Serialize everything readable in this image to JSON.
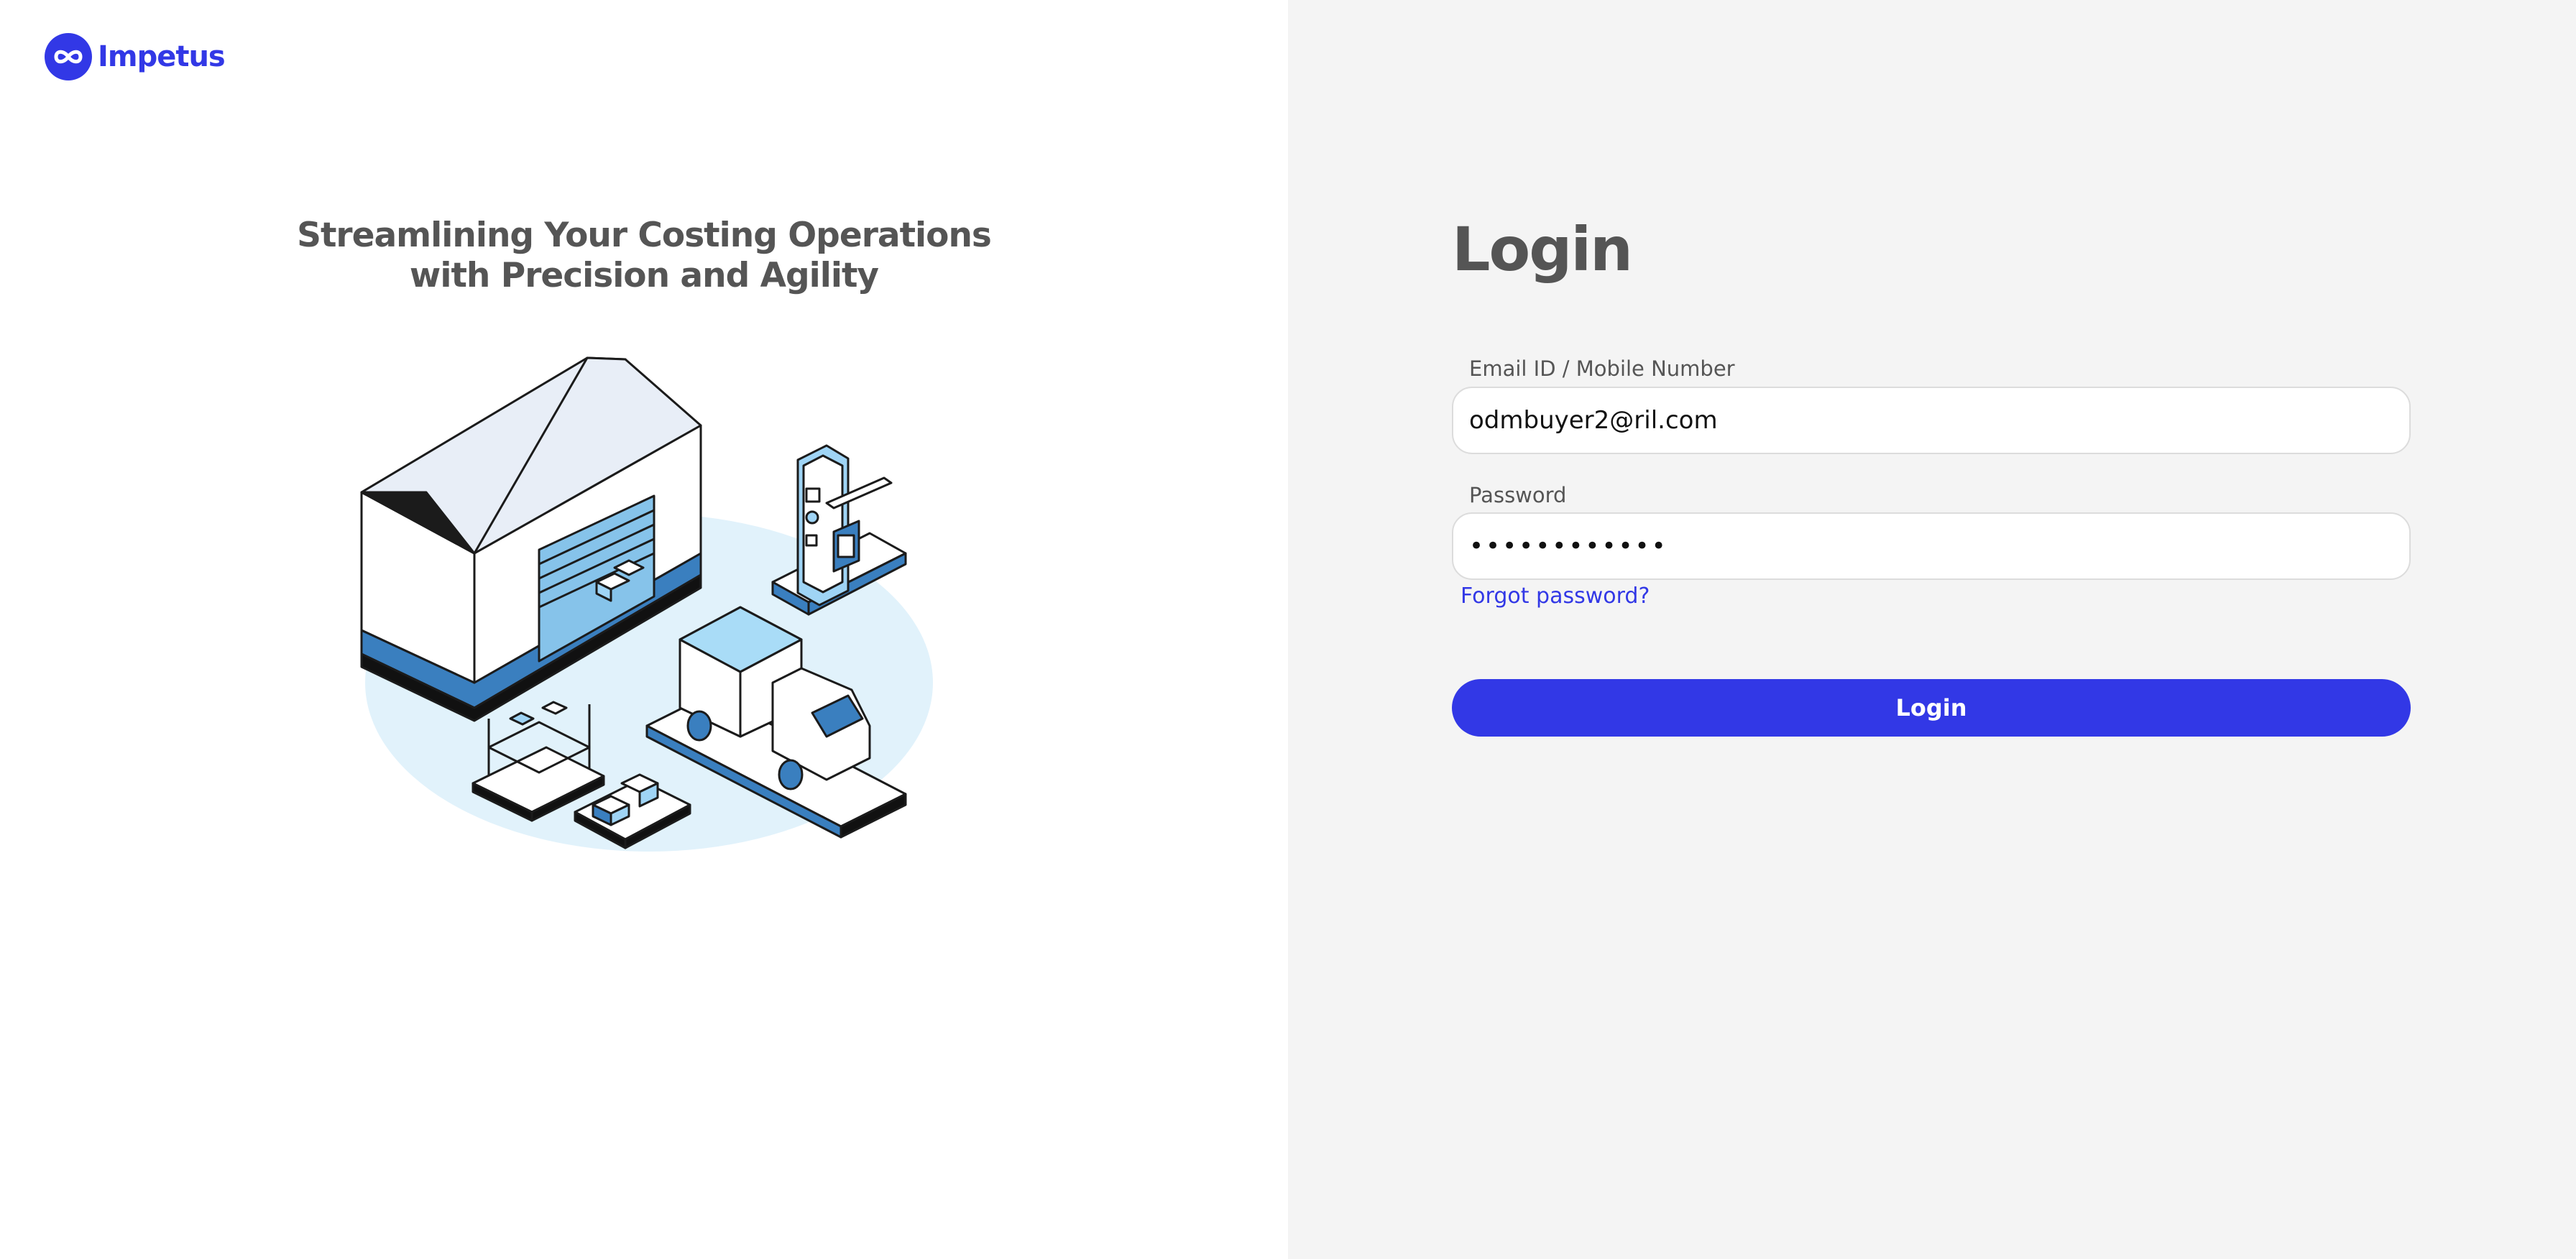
{
  "brand": {
    "name": "Impetus",
    "accent_color": "#3238e6",
    "logo_icon": "infinity-heart-icon"
  },
  "hero": {
    "tagline_line1": "Streamlining Your Costing Operations",
    "tagline_line2": "with Precision and Agility",
    "illustration": "warehouse-logistics-illustration"
  },
  "login_form": {
    "title": "Login",
    "email_label": "Email ID / Mobile Number",
    "email_value": "odmbuyer2@ril.com",
    "password_label": "Password",
    "password_value": "••••••••••••",
    "forgot_password_link": "Forgot password?",
    "submit_label": "Login"
  }
}
